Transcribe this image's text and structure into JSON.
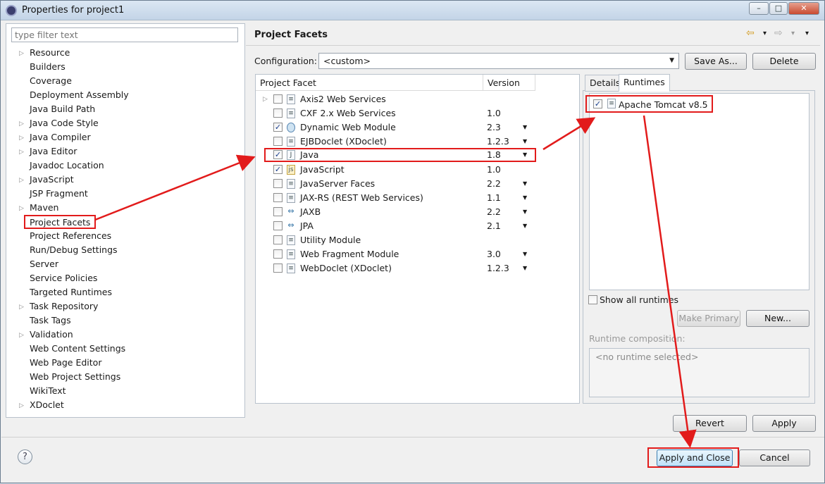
{
  "window": {
    "title": "Properties for project1",
    "controls": {
      "minimize": "–",
      "maximize": "□",
      "close": "✕"
    }
  },
  "left": {
    "filter_placeholder": "type filter text",
    "items": [
      {
        "label": "Resource",
        "expandable": true
      },
      {
        "label": "Builders",
        "expandable": false
      },
      {
        "label": "Coverage",
        "expandable": false
      },
      {
        "label": "Deployment Assembly",
        "expandable": false
      },
      {
        "label": "Java Build Path",
        "expandable": false
      },
      {
        "label": "Java Code Style",
        "expandable": true
      },
      {
        "label": "Java Compiler",
        "expandable": true
      },
      {
        "label": "Java Editor",
        "expandable": true
      },
      {
        "label": "Javadoc Location",
        "expandable": false
      },
      {
        "label": "JavaScript",
        "expandable": true
      },
      {
        "label": "JSP Fragment",
        "expandable": false
      },
      {
        "label": "Maven",
        "expandable": true
      },
      {
        "label": "Project Facets",
        "expandable": false,
        "selected": true
      },
      {
        "label": "Project References",
        "expandable": false
      },
      {
        "label": "Run/Debug Settings",
        "expandable": false
      },
      {
        "label": "Server",
        "expandable": false
      },
      {
        "label": "Service Policies",
        "expandable": false
      },
      {
        "label": "Targeted Runtimes",
        "expandable": false
      },
      {
        "label": "Task Repository",
        "expandable": true
      },
      {
        "label": "Task Tags",
        "expandable": false
      },
      {
        "label": "Validation",
        "expandable": true
      },
      {
        "label": "Web Content Settings",
        "expandable": false
      },
      {
        "label": "Web Page Editor",
        "expandable": false
      },
      {
        "label": "Web Project Settings",
        "expandable": false
      },
      {
        "label": "WikiText",
        "expandable": false
      },
      {
        "label": "XDoclet",
        "expandable": true
      }
    ]
  },
  "main": {
    "page_title": "Project Facets",
    "nav": {
      "back": "⇦",
      "back_menu": "▾",
      "forward": "⇨",
      "forward_menu": "▾",
      "menu": "▾"
    },
    "configuration": {
      "label": "Configuration:",
      "value": "<custom>",
      "save_as": "Save As...",
      "delete": "Delete"
    },
    "facets": {
      "col_facet": "Project Facet",
      "col_version": "Version",
      "rows": [
        {
          "name": "Axis2 Web Services",
          "version": "",
          "checked": false,
          "expandable": true,
          "dropdown": false,
          "icon": "page-icon"
        },
        {
          "name": "CXF 2.x Web Services",
          "version": "1.0",
          "checked": false,
          "expandable": false,
          "dropdown": false,
          "icon": "page-icon"
        },
        {
          "name": "Dynamic Web Module",
          "version": "2.3",
          "checked": true,
          "expandable": false,
          "dropdown": true,
          "icon": "globe-icon"
        },
        {
          "name": "EJBDoclet (XDoclet)",
          "version": "1.2.3",
          "checked": false,
          "expandable": false,
          "dropdown": true,
          "icon": "page-icon"
        },
        {
          "name": "Java",
          "version": "1.8",
          "checked": true,
          "expandable": false,
          "dropdown": true,
          "icon": "java-icon",
          "highlight": true
        },
        {
          "name": "JavaScript",
          "version": "1.0",
          "checked": true,
          "expandable": false,
          "dropdown": false,
          "icon": "javascript-icon"
        },
        {
          "name": "JavaServer Faces",
          "version": "2.2",
          "checked": false,
          "expandable": false,
          "dropdown": true,
          "icon": "page-icon"
        },
        {
          "name": "JAX-RS (REST Web Services)",
          "version": "1.1",
          "checked": false,
          "expandable": false,
          "dropdown": true,
          "icon": "page-icon"
        },
        {
          "name": "JAXB",
          "version": "2.2",
          "checked": false,
          "expandable": false,
          "dropdown": true,
          "icon": "arrows-icon"
        },
        {
          "name": "JPA",
          "version": "2.1",
          "checked": false,
          "expandable": false,
          "dropdown": true,
          "icon": "arrows-icon"
        },
        {
          "name": "Utility Module",
          "version": "",
          "checked": false,
          "expandable": false,
          "dropdown": false,
          "icon": "page-icon"
        },
        {
          "name": "Web Fragment Module",
          "version": "3.0",
          "checked": false,
          "expandable": false,
          "dropdown": true,
          "icon": "page-icon"
        },
        {
          "name": "WebDoclet (XDoclet)",
          "version": "1.2.3",
          "checked": false,
          "expandable": false,
          "dropdown": true,
          "icon": "page-icon"
        }
      ]
    },
    "tabs": {
      "details": "Details",
      "runtimes": "Runtimes"
    },
    "runtimes": {
      "item": "Apache Tomcat v8.5",
      "item_checked": true,
      "show_all": "Show all runtimes",
      "make_primary": "Make Primary",
      "new": "New...",
      "composition_label": "Runtime composition:",
      "composition_value": "<no runtime selected>"
    },
    "revert": "Revert",
    "apply": "Apply"
  },
  "footer": {
    "help": "?",
    "apply_close": "Apply and Close",
    "cancel": "Cancel"
  },
  "colors": {
    "highlight": "#e21b1b",
    "accent": "#3c7fb1"
  }
}
